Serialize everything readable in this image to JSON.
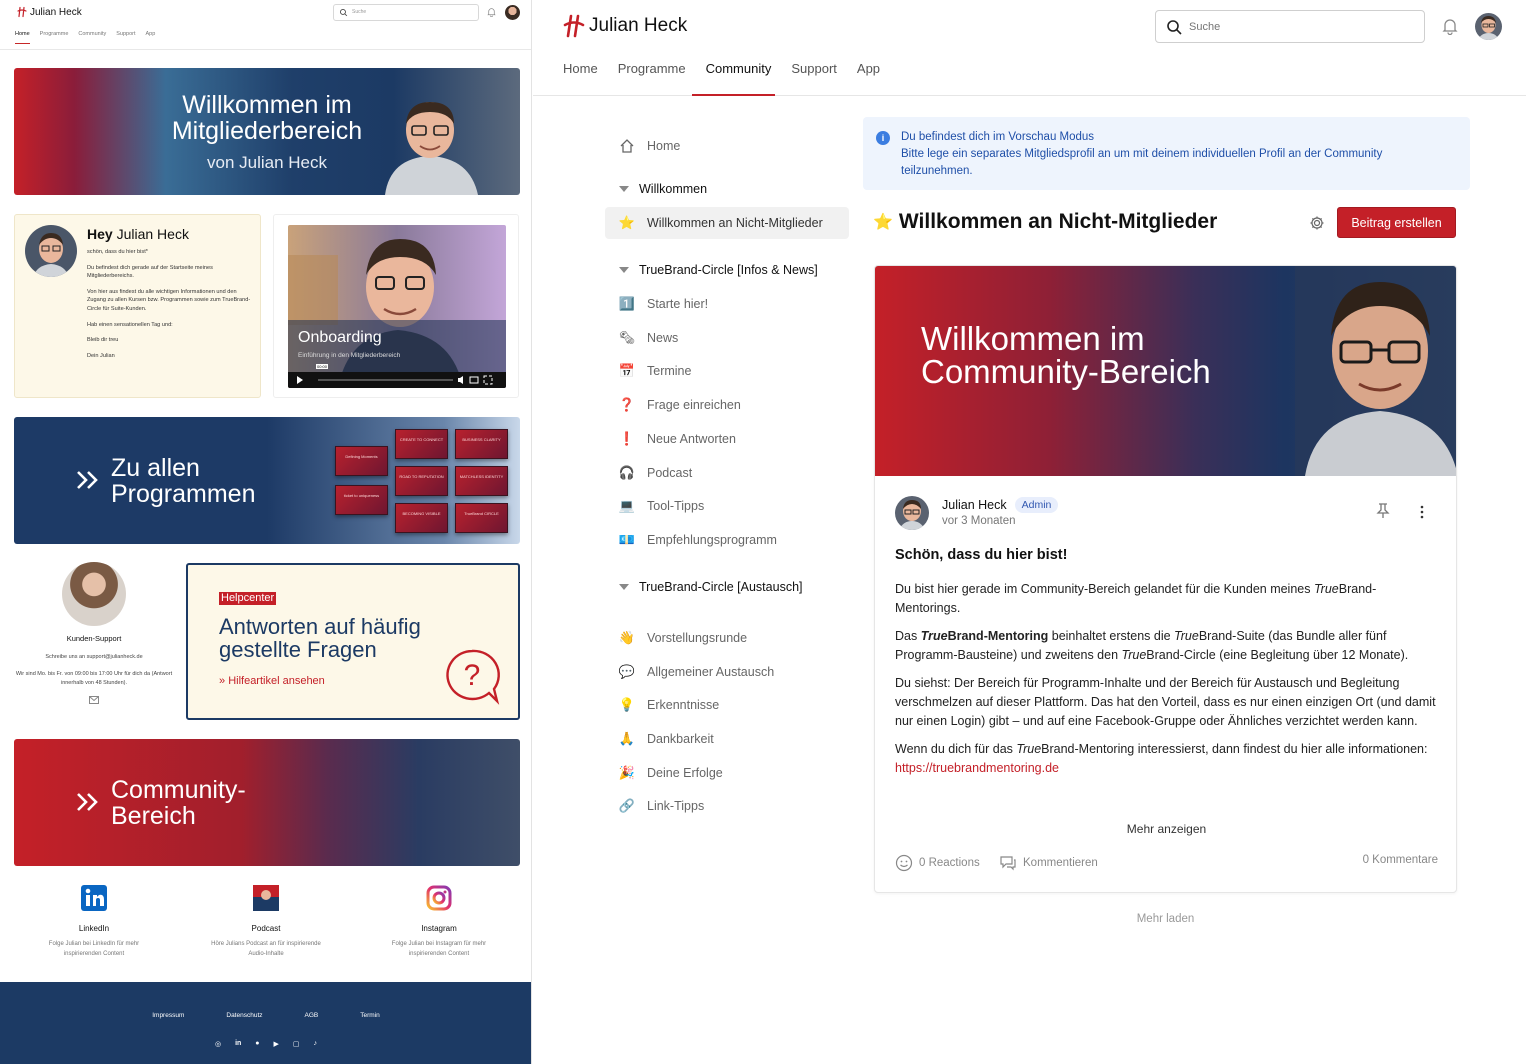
{
  "left": {
    "header": {
      "logo_text": "Julian Heck",
      "search_placeholder": "Suche",
      "nav": [
        "Home",
        "Programme",
        "Community",
        "Support",
        "App"
      ],
      "active_nav": "Home"
    },
    "welcome_banner": {
      "title_line1": "Willkommen im",
      "title_line2": "Mitgliederbereich",
      "subtitle": "von Julian Heck"
    },
    "hey_card": {
      "greeting_bold": "Hey",
      "greeting_name": "Julian Heck",
      "lines": [
        "schön, dass du hier bist*",
        "Du befindest dich gerade auf der Startseite meines Mitgliederbereichs.",
        "Von hier aus findest du alle wichtigen Informationen und den Zugang zu allen Kursen bzw. Programmen sowie zum TrueBrand-Circle für Suite-Kunden.",
        "Hab einen sensationellen Tag und:",
        "Bleib dir treu",
        "Dein Julian"
      ]
    },
    "video_card": {
      "title": "Onboarding",
      "subtitle": "Einführung in den Mitgliederbereich",
      "time": "00:00"
    },
    "programs_banner": {
      "line1": "Zu allen",
      "line2": "Programmen",
      "tiles": [
        "CREATE TO CONNECT",
        "BUSINESS CLARITY",
        "ROAD TO REPUTATION",
        "MATCHLESS IDENTITY",
        "BECOMING VISIBLE",
        "TrueBrand CIRCLE",
        "Defining Moments",
        "ticket to uniqueness"
      ]
    },
    "support": {
      "title": "Kunden-Support",
      "text1": "Schreibe uns an support@julianheck.de",
      "text2": "Wir sind Mo. bis Fr. von 09:00 bis 17:00 Uhr für dich da (Antwort innerhalb von 48 Stunden)."
    },
    "help": {
      "tag": "Helpcenter",
      "title_line1": "Antworten auf häufig",
      "title_line2": "gestellte Fragen",
      "link": "Hilfeartikel ansehen"
    },
    "community_banner": {
      "line1": "Community-",
      "line2": "Bereich"
    },
    "socials": [
      {
        "name": "LinkedIn",
        "desc": "Folge Julian bei LinkedIn für mehr inspirierenden Content"
      },
      {
        "name": "Podcast",
        "desc": "Höre Julians Podcast an für inspirierende Audio-Inhalte"
      },
      {
        "name": "Instagram",
        "desc": "Folge Julian bei Instagram für mehr inspirierenden Content"
      }
    ],
    "footer": {
      "links": [
        "Impressum",
        "Datenschutz",
        "AGB",
        "Termin"
      ]
    }
  },
  "right": {
    "header": {
      "logo_text": "Julian Heck",
      "search_placeholder": "Suche",
      "nav": [
        "Home",
        "Programme",
        "Community",
        "Support",
        "App"
      ],
      "active_nav": "Community"
    },
    "sidebar": {
      "home": "Home",
      "sections": [
        {
          "title": "Willkommen",
          "items": [
            {
              "icon": "⭐",
              "label": "Willkommen an Nicht-Mitglieder",
              "selected": true
            }
          ]
        },
        {
          "title": "TrueBrand-Circle [Infos & News]",
          "items": [
            {
              "icon": "1️⃣",
              "label": "Starte hier!"
            },
            {
              "icon": "🗞",
              "label": "News"
            },
            {
              "icon": "📅",
              "label": "Termine"
            },
            {
              "icon": "❓",
              "label": "Frage einreichen"
            },
            {
              "icon": "❗",
              "label": "Neue Antworten"
            },
            {
              "icon": "🎧",
              "label": "Podcast"
            },
            {
              "icon": "💻",
              "label": "Tool-Tipps"
            },
            {
              "icon": "💶",
              "label": "Empfehlungsprogramm"
            }
          ]
        },
        {
          "title": "TrueBrand-Circle [Austausch]",
          "items": [
            {
              "icon": "👋",
              "label": "Vorstellungsrunde"
            },
            {
              "icon": "💬",
              "label": "Allgemeiner Austausch"
            },
            {
              "icon": "💡",
              "label": "Erkenntnisse"
            },
            {
              "icon": "🙏",
              "label": "Dankbarkeit"
            },
            {
              "icon": "🎉",
              "label": "Deine Erfolge"
            },
            {
              "icon": "🔗",
              "label": "Link-Tipps"
            }
          ]
        }
      ]
    },
    "notice": {
      "title": "Du befindest dich im Vorschau Modus",
      "text": "Bitte lege ein separates Mitgliedsprofil an um mit deinem individuellen Profil an der Community teilzunehmen."
    },
    "page_title": "Willkommen an Nicht-Mitglieder",
    "create_button": "Beitrag erstellen",
    "post": {
      "hero_line1": "Willkommen im",
      "hero_line2": "Community-Bereich",
      "author": "Julian Heck",
      "badge": "Admin",
      "time": "vor 3 Monaten",
      "heading": "Schön, dass du hier bist!",
      "p1_a": "Du bist hier gerade im Community-Bereich gelandet für die Kunden meines ",
      "p1_i": "True",
      "p1_b": "Brand-Mentorings.",
      "p2_a": "Das ",
      "p2_bi": "True",
      "p2_bb": "Brand-Mentoring",
      "p2_b": " beinhaltet erstens die ",
      "p2_i2": "True",
      "p2_c": "Brand-Suite (das Bundle aller fünf Programm-Bausteine) und zweitens den ",
      "p2_i3": "True",
      "p2_d": "Brand-Circle (eine Begleitung über 12 Monate).",
      "p3": "Du siehst: Der Bereich für Programm-Inhalte und der Bereich für Austausch und Begleitung verschmelzen auf dieser Plattform. Das hat den Vorteil, dass es nur einen einzigen Ort (und damit nur einen Login) gibt – und auf eine Facebook-Gruppe oder Ähnliches verzichtet werden kann.",
      "p4_a": "Wenn du dich für das ",
      "p4_i": "True",
      "p4_b": "Brand-Mentoring interessierst, dann findest du hier alle informationen: ",
      "link": "https://truebrandmentoring.de",
      "more": "Mehr anzeigen",
      "reactions": "0 Reactions",
      "comment": "Kommentieren",
      "comments_count": "0 Kommentare"
    },
    "load_more": "Mehr laden"
  },
  "colors": {
    "brand_red": "#c42028",
    "brand_navy": "#1c3a64",
    "notice_blue": "#1f4fa8",
    "cream": "#fdf8e8"
  }
}
